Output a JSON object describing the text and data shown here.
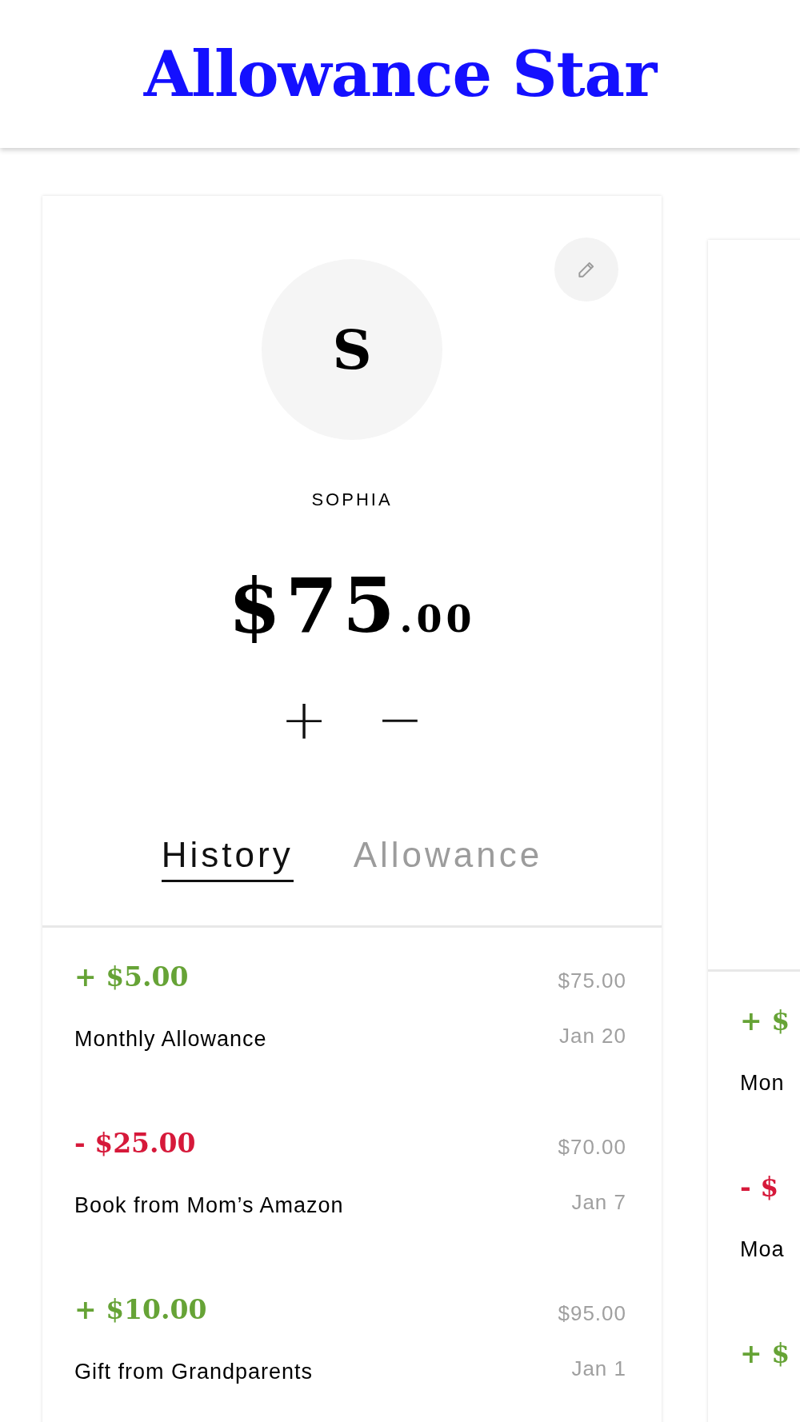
{
  "app_title": "Allowance Star",
  "cards": [
    {
      "profile": {
        "initial": "S",
        "name": "SOPHIA",
        "balance_whole": "$75",
        "balance_cents": ".00",
        "add_label": "+",
        "subtract_label": "−"
      },
      "tabs": [
        {
          "label": "History",
          "selected": true
        },
        {
          "label": "Allowance",
          "selected": false
        }
      ],
      "entries": [
        {
          "kind": "credit",
          "amount": "+ $5.00",
          "description": "Monthly Allowance",
          "balance": "$75.00",
          "date": "Jan 20"
        },
        {
          "kind": "debit",
          "amount": "- $25.00",
          "description": "Book from Mom’s Amazon",
          "balance": "$70.00",
          "date": "Jan 7"
        },
        {
          "kind": "credit",
          "amount": "+ $10.00",
          "description": "Gift from Grandparents",
          "balance": "$95.00",
          "date": "Jan 1"
        }
      ]
    },
    {
      "entries": [
        {
          "kind": "credit",
          "amount": "+ $",
          "description": "Mon"
        },
        {
          "kind": "debit",
          "amount": "- $",
          "description": "Moa"
        },
        {
          "kind": "credit",
          "amount": "+ $"
        }
      ]
    }
  ]
}
